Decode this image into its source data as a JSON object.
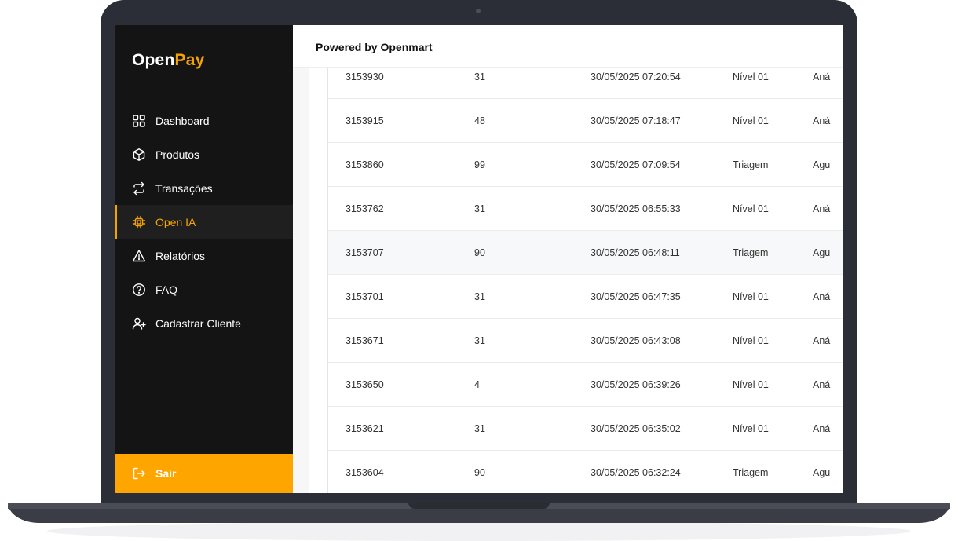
{
  "brand": {
    "open": "Open",
    "pay": "Pay",
    "accent": "#f5a300"
  },
  "sidebar": {
    "items": [
      {
        "label": "Dashboard",
        "icon": "grid-icon",
        "active": false
      },
      {
        "label": "Produtos",
        "icon": "box-icon",
        "active": false
      },
      {
        "label": "Transações",
        "icon": "swap-arrows-icon",
        "active": false
      },
      {
        "label": "Open IA",
        "icon": "chip-icon",
        "active": true
      },
      {
        "label": "Relatórios",
        "icon": "warning-triangle-icon",
        "active": false
      },
      {
        "label": "FAQ",
        "icon": "help-circle-icon",
        "active": false
      },
      {
        "label": "Cadastrar Cliente",
        "icon": "user-plus-icon",
        "active": false
      }
    ],
    "logout_label": "Sair"
  },
  "header": {
    "title": "Powered by Openmart"
  },
  "table": {
    "rows": [
      {
        "id": "3153930",
        "count": "31",
        "datetime": "30/05/2025 07:20:54",
        "level": "Nível 01",
        "status": "Aná"
      },
      {
        "id": "3153915",
        "count": "48",
        "datetime": "30/05/2025 07:18:47",
        "level": "Nível 01",
        "status": "Aná"
      },
      {
        "id": "3153860",
        "count": "99",
        "datetime": "30/05/2025 07:09:54",
        "level": "Triagem",
        "status": "Agu"
      },
      {
        "id": "3153762",
        "count": "31",
        "datetime": "30/05/2025 06:55:33",
        "level": "Nível 01",
        "status": "Aná"
      },
      {
        "id": "3153707",
        "count": "90",
        "datetime": "30/05/2025 06:48:11",
        "level": "Triagem",
        "status": "Agu"
      },
      {
        "id": "3153701",
        "count": "31",
        "datetime": "30/05/2025 06:47:35",
        "level": "Nível 01",
        "status": "Aná"
      },
      {
        "id": "3153671",
        "count": "31",
        "datetime": "30/05/2025 06:43:08",
        "level": "Nível 01",
        "status": "Aná"
      },
      {
        "id": "3153650",
        "count": "4",
        "datetime": "30/05/2025 06:39:26",
        "level": "Nível 01",
        "status": "Aná"
      },
      {
        "id": "3153621",
        "count": "31",
        "datetime": "30/05/2025 06:35:02",
        "level": "Nível 01",
        "status": "Aná"
      },
      {
        "id": "3153604",
        "count": "90",
        "datetime": "30/05/2025 06:32:24",
        "level": "Triagem",
        "status": "Agu"
      }
    ]
  }
}
